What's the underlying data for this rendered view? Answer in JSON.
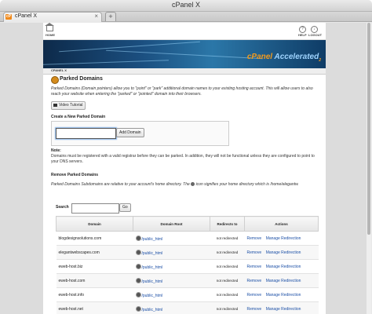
{
  "window": {
    "title": "cPanel X"
  },
  "tabs": [
    {
      "label": "cPanel X",
      "close": "×"
    }
  ],
  "new_tab_label": "+",
  "favicon_text": "cP",
  "topbar": {
    "home_label": "HOME",
    "help_label": "HELP",
    "logout_label": "LOGOUT"
  },
  "banner": {
    "brand_cp": "cPanel",
    "brand_accel": "Accelerated",
    "brand_sub": "2"
  },
  "breadcrumb": "CPANEL X",
  "page": {
    "title": "Parked Domains",
    "description": "Parked Domains (Domain pointers) allow you to \"point\" or \"park\" additional domain names to your existing hosting account. This will allow users to also reach your website when entering the \"parked\" or \"pointed\" domain into their browsers.",
    "video_button": "Video Tutorial",
    "create_heading": "Create a New Parked Domain",
    "domain_input_value": "",
    "add_button": "Add Domain",
    "note_heading": "Note:",
    "note_text": "Domains must be registered with a valid registrar before they can be parked. In addition, they will not be functional unless they are configured to point to your DNS servers.",
    "remove_heading": "Remove Parked Domains",
    "remove_desc_a": "Parked Domains Subdomains are relative to your account's home directory. The",
    "remove_desc_b": "icon signifies your home directory which is /home/elegantw.",
    "search_label": "Search",
    "search_value": "",
    "go_button": "Go"
  },
  "table": {
    "headers": [
      "Domain",
      "Domain Root",
      "Redirects to",
      "Actions"
    ],
    "rows": [
      {
        "domain": "blogdesignsolutions.com",
        "root": "/public_html",
        "redirect": "not redirected",
        "remove": "Remove",
        "manage": "Manage Redirection"
      },
      {
        "domain": "elegantwebscapes.com",
        "root": "/public_html",
        "redirect": "not redirected",
        "remove": "Remove",
        "manage": "Manage Redirection"
      },
      {
        "domain": "eweb-host.biz",
        "root": "/public_html",
        "redirect": "not redirected",
        "remove": "Remove",
        "manage": "Manage Redirection"
      },
      {
        "domain": "eweb-host.com",
        "root": "/public_html",
        "redirect": "not redirected",
        "remove": "Remove",
        "manage": "Manage Redirection"
      },
      {
        "domain": "eweb-host.info",
        "root": "/public_html",
        "redirect": "not redirected",
        "remove": "Remove",
        "manage": "Manage Redirection"
      },
      {
        "domain": "eweb-host.net",
        "root": "/public_html",
        "redirect": "not redirected",
        "remove": "Remove",
        "manage": "Manage Redirection"
      }
    ]
  }
}
